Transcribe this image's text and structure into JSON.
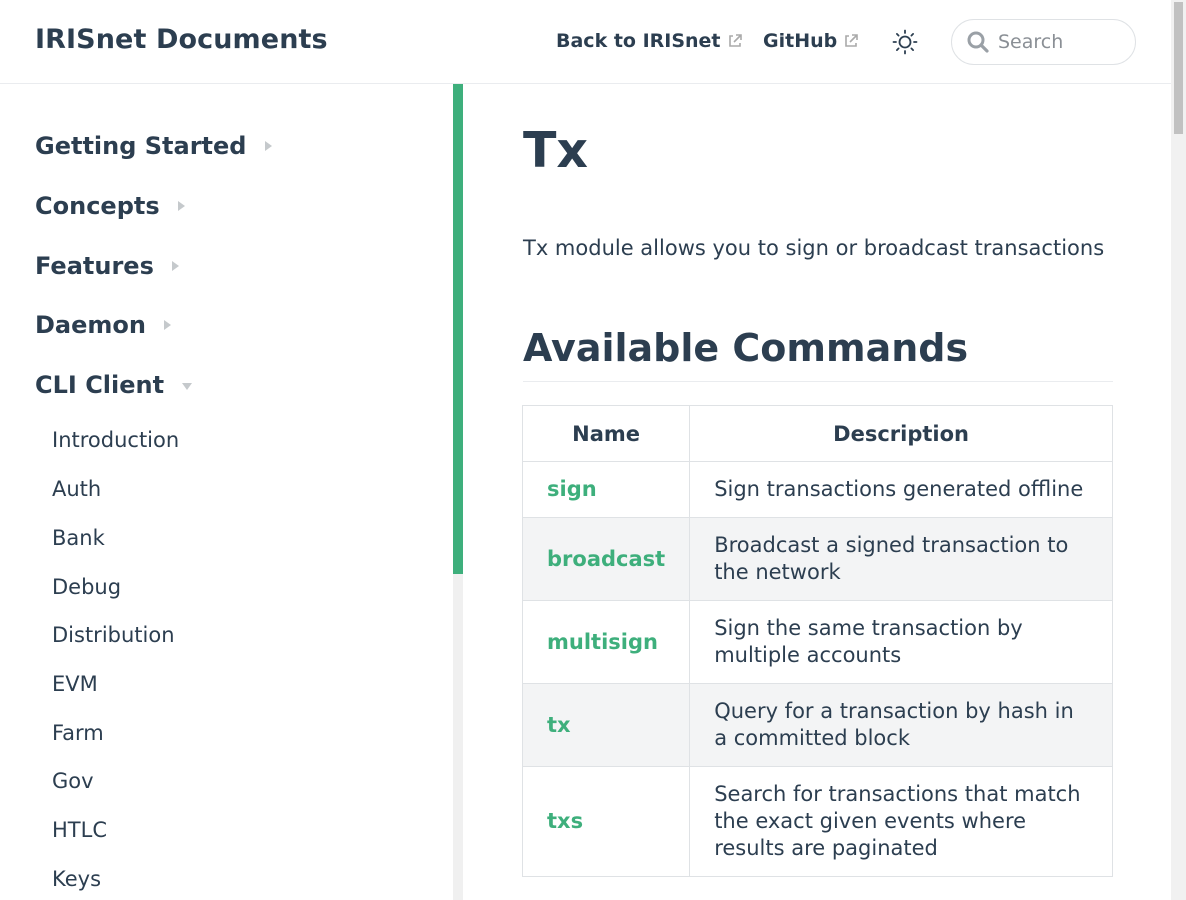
{
  "navbar": {
    "site_title": "IRISnet Documents",
    "links": [
      {
        "label": "Back to IRISnet",
        "external": true
      },
      {
        "label": "GitHub",
        "external": true
      }
    ],
    "theme_toggle_icon": "sun-icon",
    "search": {
      "placeholder": "Search",
      "icon": "search-icon"
    }
  },
  "sidebar": {
    "groups": [
      {
        "label": "Getting Started",
        "state": "collapsed"
      },
      {
        "label": "Concepts",
        "state": "collapsed"
      },
      {
        "label": "Features",
        "state": "collapsed"
      },
      {
        "label": "Daemon",
        "state": "collapsed"
      },
      {
        "label": "CLI Client",
        "state": "expanded"
      }
    ],
    "items": [
      "Introduction",
      "Auth",
      "Bank",
      "Debug",
      "Distribution",
      "EVM",
      "Farm",
      "Gov",
      "HTLC",
      "Keys"
    ]
  },
  "main": {
    "title": "Tx",
    "intro": "Tx module allows you to sign or broadcast transactions",
    "section_heading": "Available Commands",
    "table": {
      "headers": [
        "Name",
        "Description"
      ],
      "rows": [
        {
          "name": "sign",
          "desc": "Sign transactions generated offline"
        },
        {
          "name": "broadcast",
          "desc": "Broadcast a signed transaction to the network"
        },
        {
          "name": "multisign",
          "desc": "Sign the same transaction by multiple accounts"
        },
        {
          "name": "tx",
          "desc": "Query for a transaction by hash in a committed block"
        },
        {
          "name": "txs",
          "desc": "Search for transactions that match the exact given events where results are paginated"
        }
      ]
    }
  },
  "colors": {
    "accent": "#3eaf7c",
    "text": "#2c3e50",
    "border": "#dfe2e5",
    "row_alt": "#f3f4f5"
  }
}
